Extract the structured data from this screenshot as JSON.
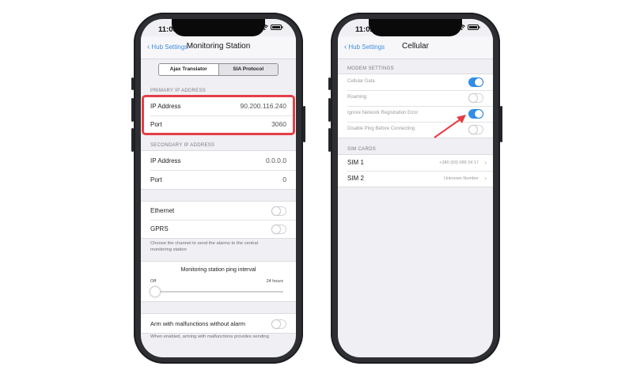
{
  "left_phone": {
    "status": {
      "time": "11:03"
    },
    "nav": {
      "back_label": "Hub Settings",
      "title": "Monitoring Station"
    },
    "segments": [
      "Ajax Translator",
      "SIA Protocol"
    ],
    "primary_header": "PRIMARY IP ADDRESS",
    "primary_rows": [
      {
        "label": "IP Address",
        "value": "90.200.116.240"
      },
      {
        "label": "Port",
        "value": "3060"
      }
    ],
    "secondary_header": "SECONDARY IP ADDRESS",
    "secondary_rows": [
      {
        "label": "IP Address",
        "value": "0.0.0.0"
      },
      {
        "label": "Port",
        "value": "0"
      }
    ],
    "channel_rows": [
      {
        "label": "Ethernet",
        "on": false
      },
      {
        "label": "GPRS",
        "on": false
      }
    ],
    "channel_footer": "Choose the channel to send the alarms to the central monitoring station",
    "ping": {
      "title": "Monitoring station ping interval",
      "min_label": "Off",
      "max_label": "24 hours",
      "level": 0
    },
    "arm_row": {
      "label": "Arm with malfunctions without alarm",
      "on": false
    },
    "arm_footer": "When enabled, arming with malfunctions provides sending"
  },
  "right_phone": {
    "status": {
      "time": "11:02"
    },
    "nav": {
      "back_label": "Hub Settings",
      "title": "Cellular"
    },
    "modem_header": "MODEM SETTINGS",
    "modem_rows": [
      {
        "label": "Cellular Data",
        "on": true
      },
      {
        "label": "Roaming",
        "on": false
      },
      {
        "label": "Ignore Network Registration Error",
        "on": true
      },
      {
        "label": "Disable Ping Before Connecting",
        "on": false
      }
    ],
    "sim_header": "SIM CARDS",
    "sim_rows": [
      {
        "label": "SIM 1",
        "value": "+380 (93) 089 24 17"
      },
      {
        "label": "SIM 2",
        "value": "Unknown Number"
      }
    ]
  },
  "colors": {
    "accent": "#2f8fe6",
    "highlight": "#e53e45",
    "background": "#efeff4"
  },
  "icons": [
    "chevron-left-icon",
    "signal-icon",
    "wifi-icon",
    "battery-icon",
    "chevron-right-icon",
    "arrow-annotation-icon"
  ]
}
